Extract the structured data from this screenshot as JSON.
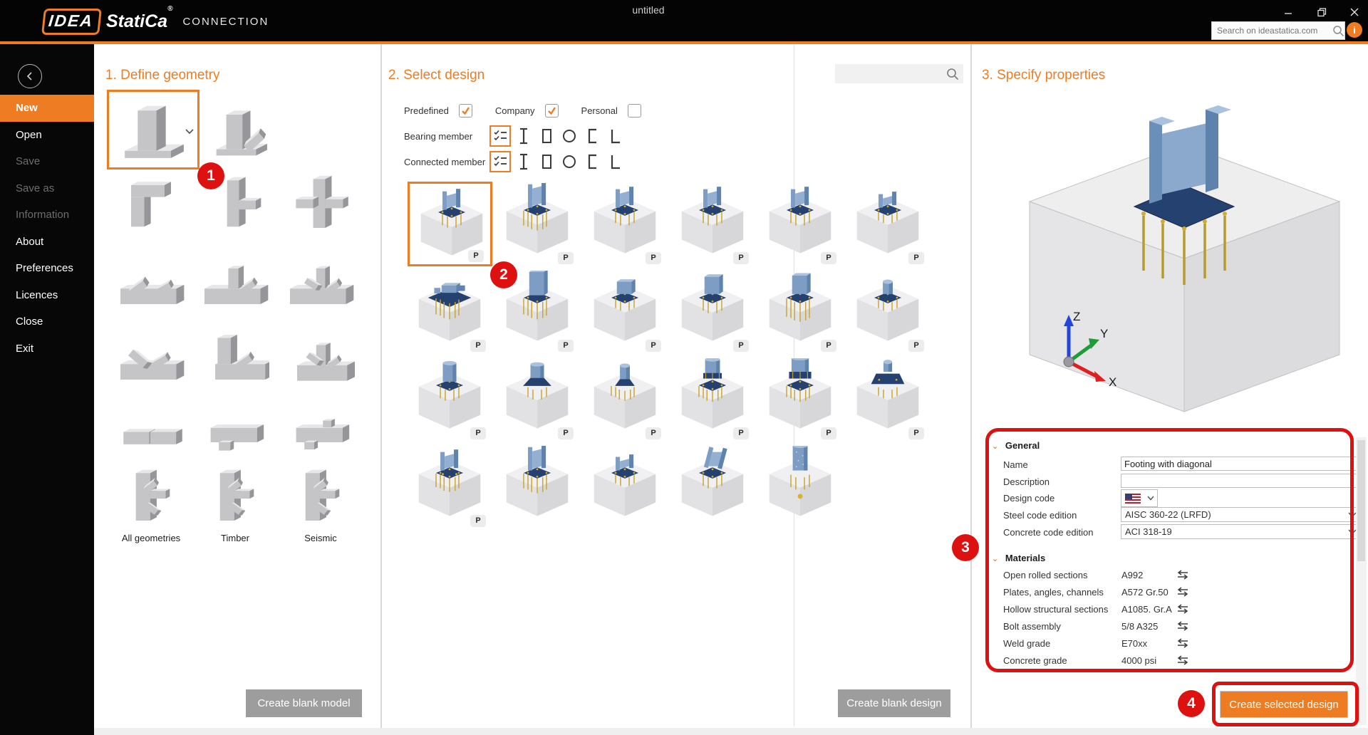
{
  "app": {
    "title": "untitled",
    "brand": {
      "idea": "IDEA",
      "statica": "StatiCa",
      "registered": "®",
      "product": "CONNECTION"
    },
    "search_placeholder": "Search on ideastatica.com",
    "info_glyph": "i",
    "icons": {
      "minimize": "minimize-icon",
      "maximize": "maximize-icon",
      "close": "close-icon",
      "search": "magnifier-icon",
      "info": "info-icon",
      "back": "chevron-left-icon",
      "dropdown": "chevron-down-icon",
      "swap": "swap-arrows-icon"
    }
  },
  "sidebar": {
    "items": [
      {
        "label": "New",
        "state": "active"
      },
      {
        "label": "Open",
        "state": "enabled"
      },
      {
        "label": "Save",
        "state": "disabled"
      },
      {
        "label": "Save as",
        "state": "disabled"
      },
      {
        "label": "Information",
        "state": "disabled"
      },
      {
        "label": "About",
        "state": "enabled"
      },
      {
        "label": "Preferences",
        "state": "enabled"
      },
      {
        "label": "Licences",
        "state": "enabled"
      },
      {
        "label": "Close",
        "state": "enabled"
      },
      {
        "label": "Exit",
        "state": "enabled"
      }
    ]
  },
  "geometry": {
    "title": "1. Define geometry",
    "footer_button": "Create blank model",
    "items": [
      {
        "shape": "column-base",
        "selected": true,
        "has_variants_dropdown": true
      },
      {
        "shape": "column-base-diagonal"
      },
      {
        "shape": "knee-joint"
      },
      {
        "shape": "column-beam"
      },
      {
        "shape": "cross-joint"
      },
      {
        "shape": "chord-with-diagonals"
      },
      {
        "shape": "chord-vertical-diagonal"
      },
      {
        "shape": "chord-fan"
      },
      {
        "shape": "chord-two-diagonals"
      },
      {
        "shape": "column-beam-diagonal"
      },
      {
        "shape": "chord-vertical-two-diagonals"
      },
      {
        "shape": "splice"
      },
      {
        "shape": "beam-bottom-stub"
      },
      {
        "shape": "beam-cross-stubs"
      },
      {
        "shape": "multi-member",
        "label": "All geometries"
      },
      {
        "shape": "multi-member",
        "label": "Timber"
      },
      {
        "shape": "multi-member",
        "label": "Seismic"
      }
    ]
  },
  "designs": {
    "title": "2. Select design",
    "footer_button": "Create blank design",
    "badge": "P",
    "filters": [
      {
        "label": "Predefined",
        "checked": true
      },
      {
        "label": "Company",
        "checked": true
      },
      {
        "label": "Personal",
        "checked": false
      }
    ],
    "member_filters": [
      {
        "label": "Bearing member"
      },
      {
        "label": "Connected member"
      }
    ],
    "section_icons": [
      "list-filter",
      "i-section",
      "box-section",
      "circular-section",
      "channel-section",
      "angle-section"
    ],
    "items": [
      {
        "shape": "wf-column-base",
        "badge": true,
        "selected": true
      },
      {
        "shape": "wf-column-base-tall",
        "badge": true
      },
      {
        "shape": "wf-column-base",
        "badge": true
      },
      {
        "shape": "wf-column-base",
        "badge": true
      },
      {
        "shape": "wf-column-base",
        "badge": true
      },
      {
        "shape": "wf-column-base-small",
        "badge": true
      },
      {
        "shape": "base-plate-channels",
        "badge": true
      },
      {
        "shape": "box-column-base-tall",
        "badge": true
      },
      {
        "shape": "box-column-base-small",
        "badge": true
      },
      {
        "shape": "box-column-base",
        "badge": true
      },
      {
        "shape": "box-column-base-anchors",
        "badge": true
      },
      {
        "shape": "pipe-column-base-small",
        "badge": true
      },
      {
        "shape": "pipe-column-base",
        "badge": true
      },
      {
        "shape": "pipe-column-base-flared",
        "badge": true
      },
      {
        "shape": "pipe-column-base-taper",
        "badge": true
      },
      {
        "shape": "pipe-column-base-ring",
        "badge": true
      },
      {
        "shape": "pipe-column-base-ring-large",
        "badge": true
      },
      {
        "shape": "pipe-column-pedestal",
        "badge": true
      },
      {
        "shape": "wf-column-base-bolted",
        "badge": true
      },
      {
        "shape": "wf-column-base-tall",
        "badge": false
      },
      {
        "shape": "wf-column-base-small",
        "badge": false
      },
      {
        "shape": "wf-column-base-inclined",
        "badge": false
      },
      {
        "shape": "pipe-column-grouted",
        "badge": false
      }
    ]
  },
  "properties": {
    "title": "3. Specify properties",
    "footer_button": "Create selected design",
    "axes": {
      "x": "X",
      "y": "Y",
      "z": "Z"
    },
    "general": {
      "header": "General",
      "fields": [
        {
          "label": "Name",
          "type": "text",
          "value": "Footing with diagonal"
        },
        {
          "label": "Description",
          "type": "text",
          "value": ""
        },
        {
          "label": "Design code",
          "type": "flag-dropdown",
          "value": "us-flag"
        },
        {
          "label": "Steel code edition",
          "type": "select",
          "value": "AISC 360-22 (LRFD)"
        },
        {
          "label": "Concrete code edition",
          "type": "select",
          "value": "ACI 318-19"
        }
      ]
    },
    "materials": {
      "header": "Materials",
      "rows": [
        {
          "label": "Open rolled sections",
          "value": "A992"
        },
        {
          "label": "Plates, angles, channels",
          "value": "A572 Gr.50"
        },
        {
          "label": "Hollow structural sections",
          "value": "A1085. Gr.A"
        },
        {
          "label": "Bolt assembly",
          "value": "5/8 A325"
        },
        {
          "label": "Weld grade",
          "value": "E70xx"
        },
        {
          "label": "Concrete grade",
          "value": "4000 psi"
        }
      ]
    }
  },
  "annotations": {
    "steps": [
      "1",
      "2",
      "3",
      "4"
    ]
  },
  "colors": {
    "accent": "#ED7C22",
    "annotation_red": "#DE1111",
    "steel_blue": "#7D9DC4",
    "plate_navy": "#25416F",
    "anchor_gold": "#C7A52F",
    "axis_x": "#E01F1F",
    "axis_y": "#1E9C38",
    "axis_z": "#2246DD"
  }
}
